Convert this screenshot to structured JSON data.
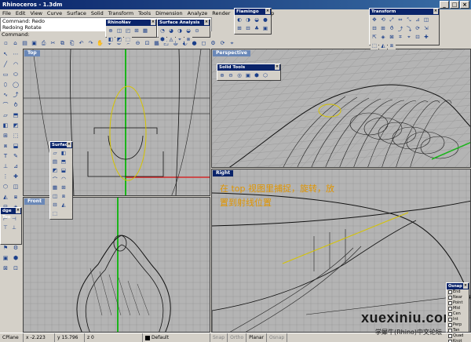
{
  "window": {
    "title": "Rhinoceros - 1.3dm",
    "minimize": "_",
    "maximize": "□",
    "close": "×"
  },
  "menu": [
    "File",
    "Edit",
    "View",
    "Curve",
    "Surface",
    "Solid",
    "Transform",
    "Tools",
    "Dimension",
    "Analyze",
    "Render",
    "Raytrace",
    "Help"
  ],
  "command_history": [
    "Command: Redo",
    "Redoing Rotate"
  ],
  "command_prompt": "Command:",
  "main_toolbar_icons": [
    "▫",
    "⌂",
    "▤",
    "▣",
    "⎙",
    "✂",
    "⧉",
    "⎗",
    "↶",
    "↷",
    "✋",
    "✥",
    "⊕",
    "⌕",
    "⊖",
    "⊡",
    "▦",
    "◰",
    "◍",
    "◐",
    "●",
    "◻",
    "⚙",
    "⟳",
    "⌖"
  ],
  "left_toolbar_icons": [
    "↖",
    "⋯",
    "╱",
    "◠",
    "▭",
    "⬭",
    "⬯",
    "◯",
    "∿",
    "⤴",
    "⌒",
    "⥁",
    "▱",
    "⬒",
    "◧",
    "◩",
    "⊞",
    "⬚",
    "⧈",
    "⬓",
    "T",
    "✎",
    "⊥",
    "⊿",
    "⋮",
    "✚",
    "⬡",
    "◫",
    "◭",
    "⧆",
    "⊟",
    "◈",
    "⌗",
    "⟲",
    "⇲",
    "⇱",
    "◉",
    "☼",
    "⚑",
    "⚙",
    "▣",
    "⬢",
    "⊠",
    "⊡"
  ],
  "viewports": {
    "top": {
      "label": "Top"
    },
    "perspective": {
      "label": "Perspective"
    },
    "front": {
      "label": "Front"
    },
    "right": {
      "label": "Right"
    }
  },
  "palettes": {
    "rhinonav": {
      "title": "RhinoNav",
      "icons": [
        "⊕",
        "◫",
        "◰",
        "⊞",
        "▦",
        "◧",
        "◩",
        "⬚"
      ]
    },
    "surface_analysis": {
      "title": "Surface Analysis",
      "icons": [
        "◔",
        "◕",
        "◑",
        "◒",
        "⊙",
        "⬢",
        "◬",
        "⌖",
        "⊗"
      ]
    },
    "flamingo": {
      "title": "Flamingo",
      "icons": [
        "◐",
        "◑",
        "◒",
        "●",
        "⊞",
        "⊟",
        "♣",
        "▣"
      ]
    },
    "transform": {
      "title": "Transform",
      "icons": [
        "✥",
        "⟲",
        "⤢",
        "⇔",
        "⤡",
        "⊿",
        "◫",
        "⊟",
        "⊞",
        "⥀",
        "⤴",
        "⤵",
        "⟳",
        "⇲",
        "⇱",
        "◈",
        "⊠",
        "⌗",
        "⌖",
        "⊡",
        "✚",
        "⬚",
        "◭",
        "⧈"
      ]
    },
    "solid_tools": {
      "title": "Solid Tools",
      "icons": [
        "⊕",
        "⊖",
        "◎",
        "▣",
        "⬢",
        "⬡"
      ]
    },
    "surface": {
      "title": "Surface",
      "icons": [
        "▱",
        "◧",
        "▤",
        "⬒",
        "◩",
        "⬓",
        "⌒",
        "◠",
        "▦",
        "⊞",
        "◫",
        "⧈",
        "⊟",
        "◭",
        "⬚"
      ]
    },
    "edge_tools": {
      "title": "dge Too",
      "icons": [
        "⊢",
        "⊣",
        "⊤",
        "⊥"
      ]
    }
  },
  "osnap": {
    "title": "Osnap",
    "items": [
      "End",
      "Near",
      "Point",
      "Mid",
      "Cen",
      "Int",
      "Perp",
      "Tan",
      "Quad",
      "Knot"
    ]
  },
  "annotation": "在 top 视图里捕捉，旋转，放置到射线位置",
  "status": {
    "cplane": "CPlane",
    "x": "x -2.223",
    "y": "y 15.796",
    "z": "z 0",
    "layer": "Default",
    "snap": "Snap",
    "ortho": "Ortho",
    "planar": "Planar",
    "osnap": "Osnap"
  },
  "watermark": {
    "site": "xuexiniu.com",
    "forum": "学犀牛(Rhino)中文论坛"
  },
  "colors": {
    "title_bar": "#0a246a",
    "viewport_bg": "#b4b4b4",
    "grid": "#9a9a9a",
    "x_axis": "#d11",
    "y_axis": "#1bb51b",
    "annotation": "#e09500"
  }
}
